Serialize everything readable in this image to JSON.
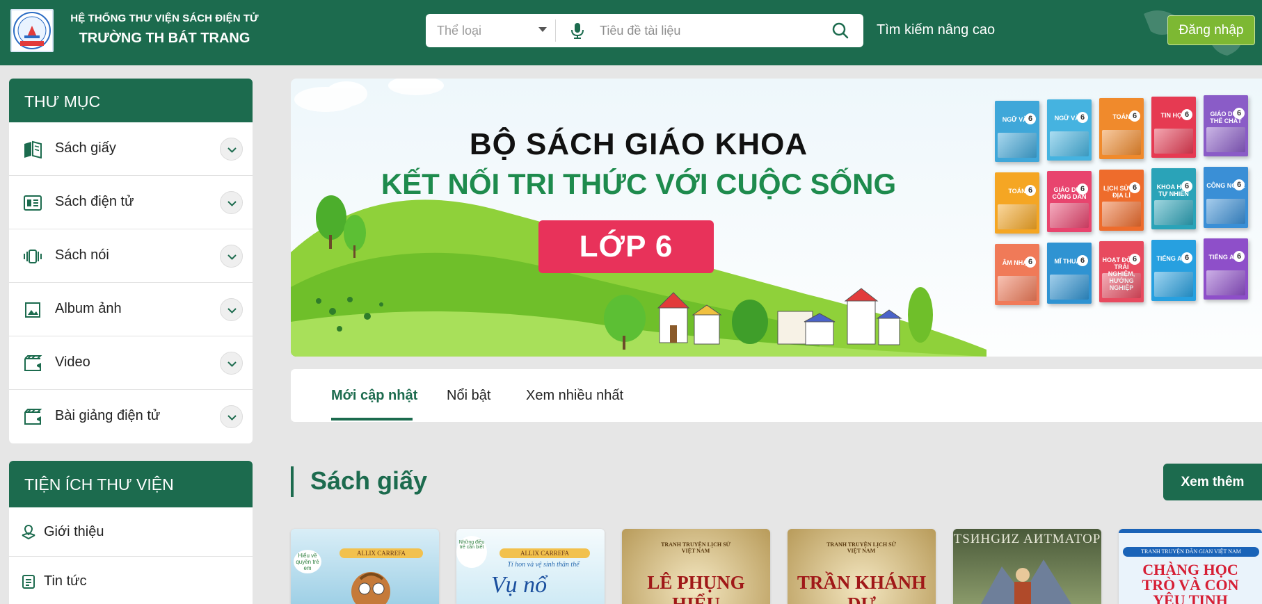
{
  "header": {
    "brand_line1": "HỆ THỐNG THƯ VIỆN SÁCH ĐIỆN TỬ",
    "brand_line2": "TRƯỜNG TH BÁT TRANG",
    "logo_text_top": "TRƯỜNG TIỂU HỌC",
    "logo_text_bottom": "BÁT TRANG",
    "search": {
      "category_placeholder": "Thể loại",
      "query_placeholder": "Tiêu đề tài liệu",
      "query_value": ""
    },
    "advanced_search": "Tìm kiếm nâng cao",
    "login": "Đăng nhập"
  },
  "sidebar": {
    "directory_title": "THƯ MỤC",
    "items": [
      {
        "label": "Sách giấy",
        "icon": "book-open-icon"
      },
      {
        "label": "Sách điện tử",
        "icon": "ebook-icon"
      },
      {
        "label": "Sách nói",
        "icon": "audio-book-icon"
      },
      {
        "label": "Album ảnh",
        "icon": "image-icon"
      },
      {
        "label": "Video",
        "icon": "video-icon"
      },
      {
        "label": "Bài giảng điện tử",
        "icon": "lecture-video-icon"
      }
    ],
    "utilities_title": "TIỆN ÍCH THƯ VIỆN",
    "utilities": [
      {
        "label": "Giới thiệu",
        "icon": "intro-icon"
      },
      {
        "label": "Tin tức",
        "icon": "news-icon"
      }
    ]
  },
  "banner": {
    "title": "BỘ SÁCH GIÁO KHOA",
    "subtitle": "KẾT NỐI TRI THỨC VỚI CUỘC SỐNG",
    "grade": "LỚP 6",
    "books": [
      {
        "title": "NGỮ VĂN",
        "num": "6",
        "color": "#3fa7d9"
      },
      {
        "title": "NGỮ VĂN",
        "num": "6",
        "color": "#45b3e0"
      },
      {
        "title": "TOÁN",
        "num": "6",
        "color": "#f08a2c"
      },
      {
        "title": "TIN HỌC",
        "num": "6",
        "color": "#e63a52"
      },
      {
        "title": "GIÁO DỤC THỂ CHẤT",
        "num": "6",
        "color": "#8a5cc7"
      },
      {
        "title": "TOÁN",
        "num": "6",
        "color": "#f5a623"
      },
      {
        "title": "GIÁO DỤC CÔNG DÂN",
        "num": "6",
        "color": "#e8446e"
      },
      {
        "title": "LỊCH SỬ VÀ ĐỊA LÍ",
        "num": "6",
        "color": "#ee6c2c"
      },
      {
        "title": "KHOA HỌC TỰ NHIÊN",
        "num": "6",
        "color": "#2aa3b8"
      },
      {
        "title": "CÔNG NGHỆ",
        "num": "6",
        "color": "#3a8fd6"
      },
      {
        "title": "ÂM NHẠC",
        "num": "6",
        "color": "#f07a58"
      },
      {
        "title": "MĨ THUẬT",
        "num": "6",
        "color": "#2f93d2"
      },
      {
        "title": "HOẠT ĐỘNG TRẢI NGHIỆM, HƯỚNG NGHIỆP",
        "num": "6",
        "color": "#e84a5f"
      },
      {
        "title": "TIẾNG ANH",
        "num": "6",
        "color": "#27a0e0"
      },
      {
        "title": "TIẾNG ANH",
        "num": "6",
        "color": "#8e4fc9"
      }
    ]
  },
  "tabs": [
    {
      "label": "Mới cập nhật",
      "active": true
    },
    {
      "label": "Nổi bật",
      "active": false
    },
    {
      "label": "Xem nhiều nhất",
      "active": false
    }
  ],
  "section": {
    "title": "Sách giấy",
    "more": "Xem thêm"
  },
  "cards": [
    {
      "top_text": "ALLIX CARREFA",
      "side_text": "Hiểu về quyền trẻ em",
      "main": ""
    },
    {
      "top_text": "ALLIX CARREFA",
      "side_text": "Những điều trẻ cần biết",
      "main": "Vụ nổ",
      "caption": "Tí hon và vệ sinh thân thể"
    },
    {
      "top_text": "TRANH TRUYỆN LỊCH SỬ VIỆT NAM",
      "main": "LÊ PHỤNG HIỂU"
    },
    {
      "top_text": "TRANH TRUYỆN LỊCH SỬ VIỆT NAM",
      "main": "TRẦN KHÁNH DƯ"
    },
    {
      "top_text": "ТSИНGИZ AИТМАТОР",
      "main": ""
    },
    {
      "top_text": "TRANH TRUYỆN DÂN GIAN VIỆT NAM",
      "main": "CHÀNG HỌC TRÒ VÀ CON YÊU TINH"
    }
  ],
  "colors": {
    "primary": "#1c6b4e",
    "login_green": "#7db833",
    "grade_pink": "#e8325a",
    "banner_subtitle_green": "#1e8b4d"
  }
}
